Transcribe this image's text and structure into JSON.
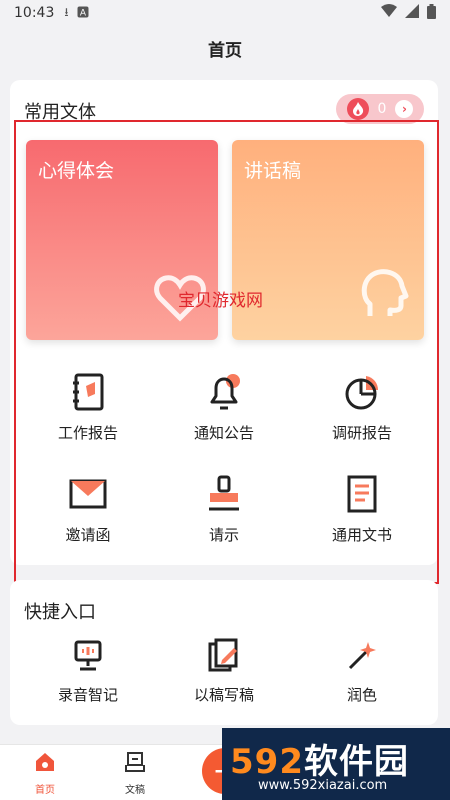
{
  "status": {
    "time": "10:43",
    "left_icons": [
      "download-icon",
      "a-badge-icon"
    ],
    "right_icons": [
      "wifi-icon",
      "signal-icon",
      "battery-icon"
    ]
  },
  "header": {
    "title": "首页"
  },
  "styles_section": {
    "title": "常用文体",
    "count": "0",
    "big_tiles": [
      {
        "label": "心得体会",
        "icon": "heart-icon",
        "color_top": "#f76a6f",
        "color_bottom": "#fca59a"
      },
      {
        "label": "讲话稿",
        "icon": "speaking-head-icon",
        "color_top": "#ffb07d",
        "color_bottom": "#fed2a1"
      }
    ],
    "items": [
      {
        "label": "工作报告",
        "icon": "notebook-icon"
      },
      {
        "label": "通知公告",
        "icon": "bell-icon"
      },
      {
        "label": "调研报告",
        "icon": "pie-chart-icon"
      },
      {
        "label": "邀请函",
        "icon": "envelope-icon"
      },
      {
        "label": "请示",
        "icon": "stamp-icon"
      },
      {
        "label": "通用文书",
        "icon": "document-icon"
      }
    ]
  },
  "watermark": "宝贝游戏网",
  "quick_section": {
    "title": "快捷入口",
    "items": [
      {
        "label": "录音智记",
        "icon": "recorder-icon"
      },
      {
        "label": "以稿写稿",
        "icon": "edit-document-icon"
      },
      {
        "label": "润色",
        "icon": "magic-wand-icon"
      }
    ]
  },
  "bottom_nav": {
    "items": [
      {
        "label": "首页",
        "icon": "home-icon",
        "active": true
      },
      {
        "label": "文稿",
        "icon": "document-stack-icon",
        "active": false
      }
    ],
    "fab_symbol": "+"
  },
  "brand_overlay": {
    "big_num": "592",
    "big_text": "软件园",
    "url": "www.592xiazai.com"
  },
  "colors": {
    "accent": "#f0553b",
    "highlight_border": "#e0282e",
    "icon_accent": "#f77a5c"
  }
}
